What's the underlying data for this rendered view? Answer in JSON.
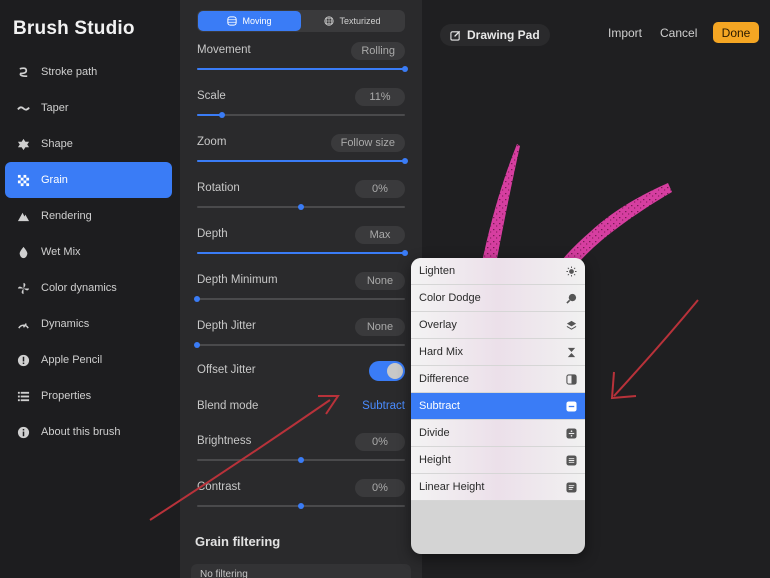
{
  "app": {
    "title": "Brush Studio"
  },
  "sidebar": {
    "items": [
      {
        "label": "Stroke path",
        "icon": "stroke-path-icon"
      },
      {
        "label": "Taper",
        "icon": "taper-icon"
      },
      {
        "label": "Shape",
        "icon": "shape-icon"
      },
      {
        "label": "Grain",
        "icon": "grain-icon",
        "active": true
      },
      {
        "label": "Rendering",
        "icon": "rendering-icon"
      },
      {
        "label": "Wet Mix",
        "icon": "wet-mix-icon"
      },
      {
        "label": "Color dynamics",
        "icon": "color-dynamics-icon"
      },
      {
        "label": "Dynamics",
        "icon": "dynamics-icon"
      },
      {
        "label": "Apple Pencil",
        "icon": "apple-pencil-icon"
      },
      {
        "label": "Properties",
        "icon": "properties-icon"
      },
      {
        "label": "About this brush",
        "icon": "info-icon"
      }
    ]
  },
  "panel": {
    "segments": {
      "moving": "Moving",
      "texturized": "Texturized"
    },
    "settings": [
      {
        "label": "Movement",
        "value": "Rolling",
        "level": 1.0
      },
      {
        "label": "Scale",
        "value": "11%",
        "level": 0.12
      },
      {
        "label": "Zoom",
        "value": "Follow size",
        "level": 1.0
      },
      {
        "label": "Rotation",
        "value": "0%",
        "level": 0.5
      },
      {
        "label": "Depth",
        "value": "Max",
        "level": 1.0
      },
      {
        "label": "Depth Minimum",
        "value": "None",
        "level": 0.0
      },
      {
        "label": "Depth Jitter",
        "value": "None",
        "level": 0.0
      }
    ],
    "offset_jitter": {
      "label": "Offset Jitter",
      "on": true
    },
    "blend_mode": {
      "label": "Blend mode",
      "value": "Subtract"
    },
    "settings2": [
      {
        "label": "Brightness",
        "value": "0%",
        "level": 0.5
      },
      {
        "label": "Contrast",
        "value": "0%",
        "level": 0.5
      }
    ],
    "grain_filtering": {
      "title": "Grain filtering",
      "option": "No filtering"
    }
  },
  "pad": {
    "title": "Drawing Pad",
    "import": "Import",
    "cancel": "Cancel",
    "done": "Done"
  },
  "blend_menu": {
    "items": [
      {
        "label": "Lighten",
        "icon": "lighten-icon"
      },
      {
        "label": "Color Dodge",
        "icon": "color-dodge-icon"
      },
      {
        "label": "Overlay",
        "icon": "overlay-icon"
      },
      {
        "label": "Hard Mix",
        "icon": "hard-mix-icon"
      },
      {
        "label": "Difference",
        "icon": "difference-icon"
      },
      {
        "label": "Subtract",
        "icon": "subtract-icon",
        "selected": true
      },
      {
        "label": "Divide",
        "icon": "divide-icon"
      },
      {
        "label": "Height",
        "icon": "height-icon"
      },
      {
        "label": "Linear Height",
        "icon": "linear-height-icon"
      }
    ]
  },
  "colors": {
    "accent": "#3a7cf6",
    "done": "#f5a623",
    "stroke": "#d63ea0",
    "annotation": "#b8323a"
  }
}
